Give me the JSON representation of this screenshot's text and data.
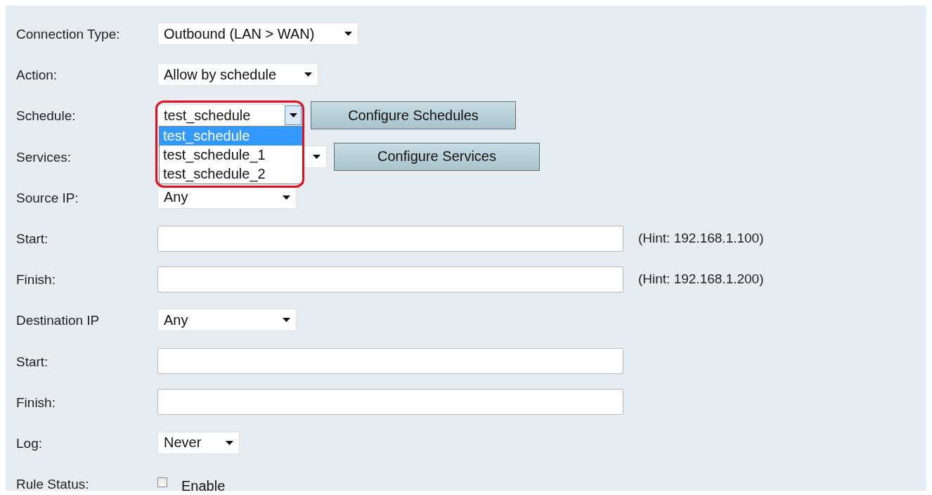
{
  "rows": [
    {
      "kind": "select",
      "label": "Connection Type:",
      "value": "Outbound (LAN > WAN)"
    },
    {
      "kind": "select",
      "label": "Action:",
      "value": "Allow by schedule"
    },
    {
      "kind": "select",
      "label": "Schedule:",
      "value": "test_schedule",
      "open": true,
      "highlighted": true,
      "options": [
        {
          "label": "test_schedule",
          "selected": true
        },
        {
          "label": "test_schedule_1",
          "selected": false
        },
        {
          "label": "test_schedule_2",
          "selected": false
        }
      ],
      "button": "Configure Schedules"
    },
    {
      "kind": "select",
      "label": "Services:",
      "button": "Configure Services"
    },
    {
      "kind": "select",
      "label": "Source IP:",
      "value": "Any"
    },
    {
      "kind": "text",
      "label": "Start:",
      "hint": "(Hint: 192.168.1.100)"
    },
    {
      "kind": "text",
      "label": "Finish:",
      "hint": "(Hint: 192.168.1.200)"
    },
    {
      "kind": "select",
      "label": "Destination IP",
      "value": "Any"
    },
    {
      "kind": "text",
      "label": "Start:"
    },
    {
      "kind": "text",
      "label": "Finish:"
    },
    {
      "kind": "select",
      "label": "Log:",
      "value": "Never"
    },
    {
      "kind": "checkbox",
      "label": "Rule Status:",
      "text": "Enable",
      "checked": false
    }
  ]
}
